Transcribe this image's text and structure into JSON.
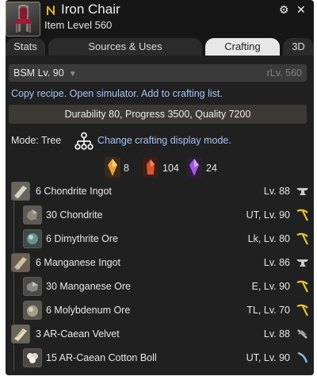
{
  "item": {
    "name": "Iron Chair",
    "level_text": "Item Level 560",
    "icon": "iron-chair-icon"
  },
  "window_controls": {
    "settings_icon": "⚙",
    "close_icon": "✕"
  },
  "tabs": [
    {
      "label": "Stats",
      "active": false
    },
    {
      "label": "Sources & Uses",
      "active": false
    },
    {
      "label": "Crafting",
      "active": true
    },
    {
      "label": "3D",
      "active": false
    }
  ],
  "recipe": {
    "job_level": "BSM Lv. 90",
    "rlv": "rLv. 560",
    "links": {
      "copy": "Copy recipe.",
      "simulator": "Open simulator.",
      "crafting_list": "Add to crafting list."
    },
    "stats": "Durability 80, Progress 3500, Quality 7200"
  },
  "mode": {
    "label": "Mode: Tree",
    "change_link": "Change crafting display mode."
  },
  "crystals": [
    {
      "name": "fire-crystal-icon",
      "count": "8",
      "color": "#e8a23a"
    },
    {
      "name": "fire-cluster-icon",
      "count": "104",
      "color": "#d9532c"
    },
    {
      "name": "wind-cluster-icon",
      "count": "24",
      "color": "#a25ad8"
    }
  ],
  "materials": [
    {
      "label": "6 Chondrite Ingot",
      "level": "Lv. 88",
      "icon": "ingot-icon",
      "job": "anvil-icon"
    },
    {
      "label": "30 Chondrite",
      "level": "UT, Lv. 90",
      "icon": "ore-icon",
      "job": "pickaxe-icon"
    },
    {
      "label": "6 Dimythrite Ore",
      "level": "Lk, Lv. 80",
      "icon": "ore-icon",
      "job": "pickaxe-icon"
    },
    {
      "label": "6 Manganese Ingot",
      "level": "Lv. 86",
      "icon": "ingot-icon",
      "job": "anvil-icon"
    },
    {
      "label": "30 Manganese Ore",
      "level": "E, Lv. 90",
      "icon": "ore-icon",
      "job": "pickaxe-icon"
    },
    {
      "label": "6 Molybdenum Ore",
      "level": "TL, Lv. 70",
      "icon": "ore-icon",
      "job": "pickaxe-icon"
    },
    {
      "label": "3 AR-Caean Velvet",
      "level": "Lv. 88",
      "icon": "cloth-icon",
      "job": "needle-icon"
    },
    {
      "label": "15 AR-Caean Cotton Boll",
      "level": "UT, Lv. 90",
      "icon": "cotton-icon",
      "job": "sickle-icon"
    }
  ],
  "colors": {
    "link": "#a5c4f5",
    "panel": "#202020",
    "tool_yellow": "#e8c23a"
  }
}
